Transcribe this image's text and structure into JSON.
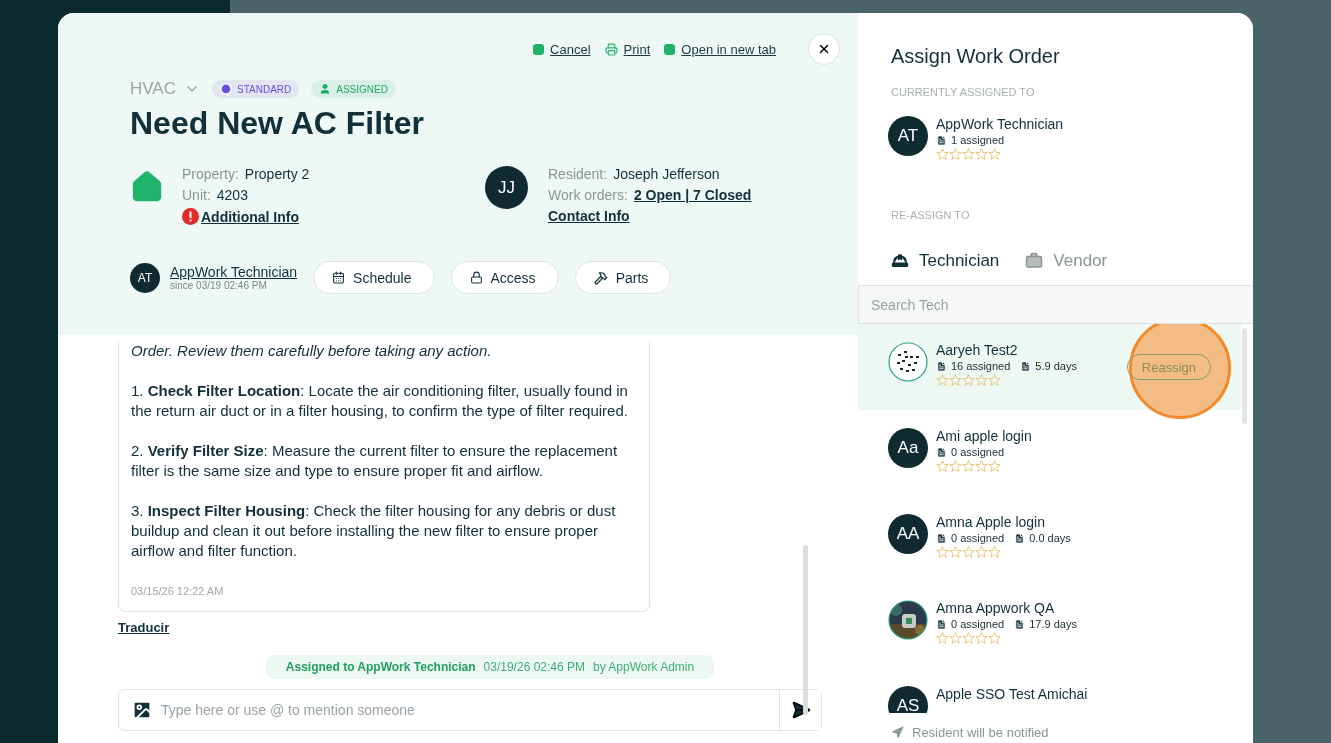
{
  "work_order": {
    "links": [
      "Cancel",
      "Print",
      "Open in new tab"
    ],
    "category": "HVAC",
    "badges": [
      {
        "kind": "priority",
        "label": "STANDARD",
        "color": "#6c4fd8"
      },
      {
        "kind": "status",
        "label": "ASSIGNED",
        "color": "#1faa63"
      }
    ],
    "title": "Need New AC Filter",
    "property": {
      "label": "Property:",
      "value": "Property 2"
    },
    "unit": {
      "label": "Unit:",
      "value": "4203"
    },
    "additional_info": "Additional Info",
    "resident": {
      "initials": "JJ",
      "label": "Resident:",
      "value": "Joseph Jefferson"
    },
    "work_orders": {
      "label": "Work orders:",
      "value": "2 Open | 7 Closed"
    },
    "contact_info": "Contact Info",
    "assignee": {
      "initials": "AT",
      "name": "AppWork Technician",
      "since": "since 03/19 02:46 PM"
    },
    "actions": [
      {
        "kind": "schedule",
        "label": "Schedule"
      },
      {
        "kind": "access",
        "label": "Access"
      },
      {
        "kind": "parts",
        "label": "Parts"
      }
    ],
    "message": {
      "intro": "Order. Review them carefully before taking any action.",
      "steps": [
        "1. **Check Filter Location**: Locate the air conditioning filter, usually found in the return air duct or in a filter housing, to confirm the type of filter required.",
        "2. **Verify Filter Size**: Measure the current filter to ensure the replacement filter is the same size and type to ensure proper fit and airflow.",
        "3. **Inspect Filter Housing**: Check the filter housing for any debris or dust buildup and clean it out before installing the new filter to ensure proper airflow and filter function."
      ],
      "time": "03/15/26 12:22 AM"
    },
    "translate": "Traducir",
    "event": {
      "text": "Assigned to AppWork Technician",
      "time": "03/19/26 02:46 PM",
      "by": "by AppWork Admin"
    },
    "composer": {
      "placeholder": "Type here or use @ to mention someone"
    }
  },
  "assign_panel": {
    "title": "Assign Work Order",
    "current_label": "CURRENTLY ASSIGNED TO",
    "current": {
      "initials": "AT",
      "name": "AppWork Technician",
      "assigned": "1 assigned",
      "stars": 0
    },
    "reassign_label": "RE-ASSIGN TO",
    "tabs": [
      {
        "kind": "technician",
        "label": "Technician",
        "selected": true
      },
      {
        "kind": "vendor",
        "label": "Vendor",
        "selected": false
      }
    ],
    "search": {
      "placeholder": "Search Tech"
    },
    "technicians": [
      {
        "kind": "pattern",
        "name": "Aaryeh Test2",
        "assigned": "16 assigned",
        "days": "5.9 days",
        "stars": 0,
        "highlighted": true,
        "action": "Reassign"
      },
      {
        "kind": "initials",
        "initials": "Aa",
        "name": "Ami apple login",
        "assigned": "0 assigned",
        "stars": 0,
        "highlighted": false
      },
      {
        "kind": "initials",
        "initials": "AA",
        "name": "Amna Apple login",
        "assigned": "0 assigned",
        "days": "0.0 days",
        "stars": 0,
        "highlighted": false
      },
      {
        "kind": "picture",
        "name": "Amna Appwork QA",
        "assigned": "0 assigned",
        "days": "17.9 days",
        "stars": 0,
        "highlighted": false
      },
      {
        "kind": "initials",
        "initials": "AS",
        "name": "Apple SSO Test Amichai",
        "highlighted": false
      }
    ],
    "footer": "Resident will be notified"
  }
}
